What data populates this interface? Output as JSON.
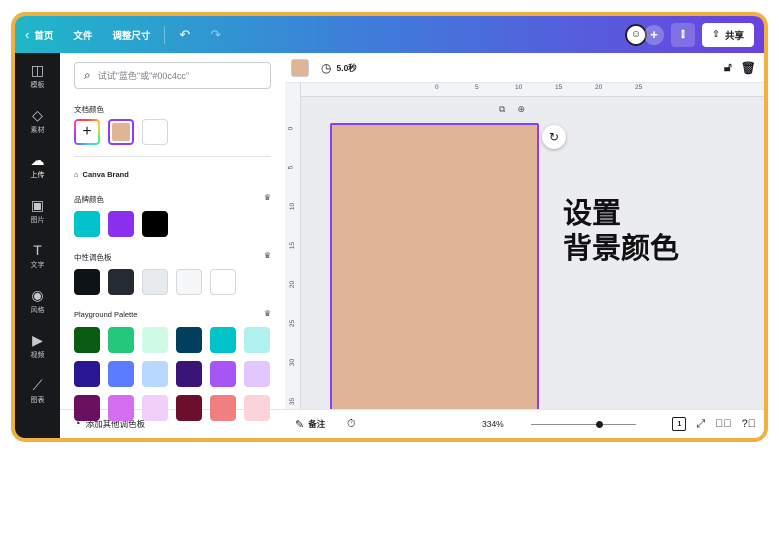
{
  "topbar": {
    "home_label": "首页",
    "file_label": "文件",
    "resize_label": "调整尺寸",
    "share_label": "共享"
  },
  "rail": {
    "items": [
      {
        "label": "模板",
        "icon": "template-icon"
      },
      {
        "label": "素材",
        "icon": "elements-icon"
      },
      {
        "label": "上传",
        "icon": "upload-icon"
      },
      {
        "label": "图片",
        "icon": "photos-icon"
      },
      {
        "label": "文字",
        "icon": "text-icon"
      },
      {
        "label": "风格",
        "icon": "styles-icon"
      },
      {
        "label": "视频",
        "icon": "video-icon"
      },
      {
        "label": "图表",
        "icon": "charts-icon"
      }
    ]
  },
  "panel": {
    "search_placeholder": "试试\"蓝色\"或\"#00c4cc\"",
    "doc_colors_title": "文档颜色",
    "brand_title": "Canva Brand",
    "brand_colors_title": "品牌颜色",
    "neutral_title": "中性调色板",
    "playground_title": "Playground Palette",
    "footer_label": "添加其他调色板"
  },
  "colors": {
    "doc": [
      "#e0b597",
      "#ffffff"
    ],
    "brand": [
      "#00c4cc",
      "#8b2ef0",
      "#000000"
    ],
    "neutral": [
      "#0e1318",
      "#252b33",
      "#e8ebee",
      "#f6f7f8",
      "#ffffff"
    ],
    "playground": [
      [
        "#0a5c13",
        "#23c87a",
        "#cdfbe4",
        "#013f5e",
        "#00c4c9",
        "#b0f1f0"
      ],
      [
        "#2a1794",
        "#5c7cff",
        "#b9d8ff",
        "#3b1478",
        "#a855f7",
        "#e1c6ff"
      ],
      [
        "#6b0f5f",
        "#d46ef0",
        "#f0cff9",
        "#6a0f2c",
        "#f27f7f",
        "#fcd3d9"
      ]
    ],
    "page_background": "#e0b597",
    "selection_accent": "#8b3dff"
  },
  "editor": {
    "duration": "5.0秒",
    "ruler_top": [
      "0",
      "5",
      "10",
      "15",
      "20",
      "25"
    ],
    "ruler_left": [
      "0",
      "5",
      "10",
      "15",
      "20",
      "25",
      "30",
      "35"
    ],
    "overlay_line1": "设置",
    "overlay_line2": "背景颜色",
    "notes_label": "备注",
    "zoom": "334%",
    "zoom_level": 0.65,
    "page_number": "1"
  }
}
